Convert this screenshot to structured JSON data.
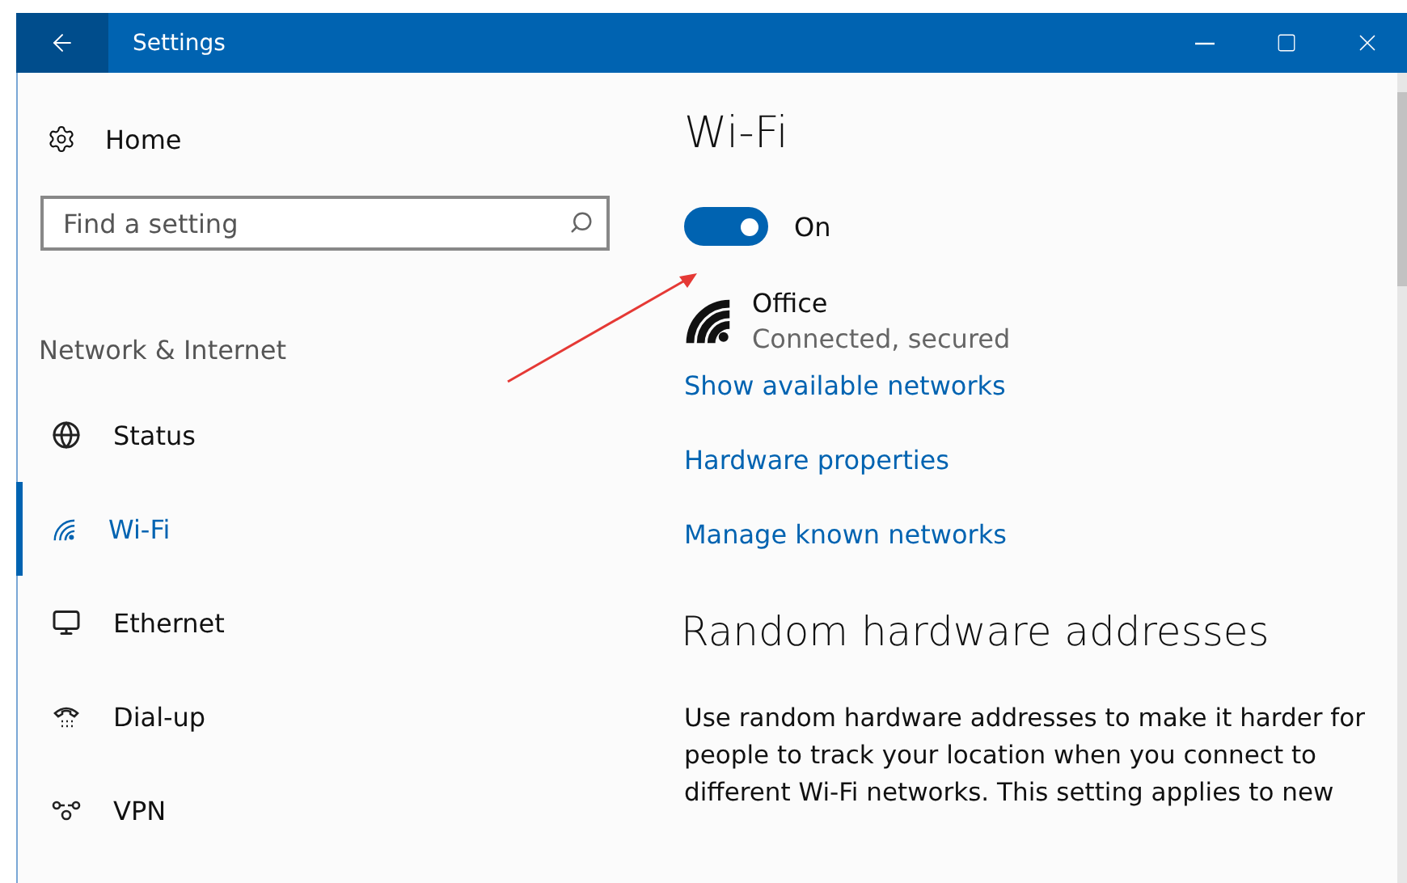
{
  "window": {
    "title": "Settings"
  },
  "sidebar": {
    "home": "Home",
    "search": {
      "placeholder": "Find a setting"
    },
    "section": "Network & Internet",
    "items": [
      {
        "label": "Status",
        "kind": "status",
        "selected": false
      },
      {
        "label": "Wi-Fi",
        "kind": "wifi",
        "selected": true
      },
      {
        "label": "Ethernet",
        "kind": "ethernet",
        "selected": false
      },
      {
        "label": "Dial-up",
        "kind": "dialup",
        "selected": false
      },
      {
        "label": "VPN",
        "kind": "vpn",
        "selected": false
      }
    ]
  },
  "content": {
    "title": "Wi-Fi",
    "toggle": {
      "on": true,
      "label": "On"
    },
    "network": {
      "name": "Office",
      "status": "Connected, secured"
    },
    "links": [
      "Show available networks",
      "Hardware properties",
      "Manage known networks"
    ],
    "section_title": "Random hardware addresses",
    "paragraph": "Use random hardware addresses to make it harder for people to track your location when you connect to different Wi-Fi networks. This setting applies to new"
  }
}
